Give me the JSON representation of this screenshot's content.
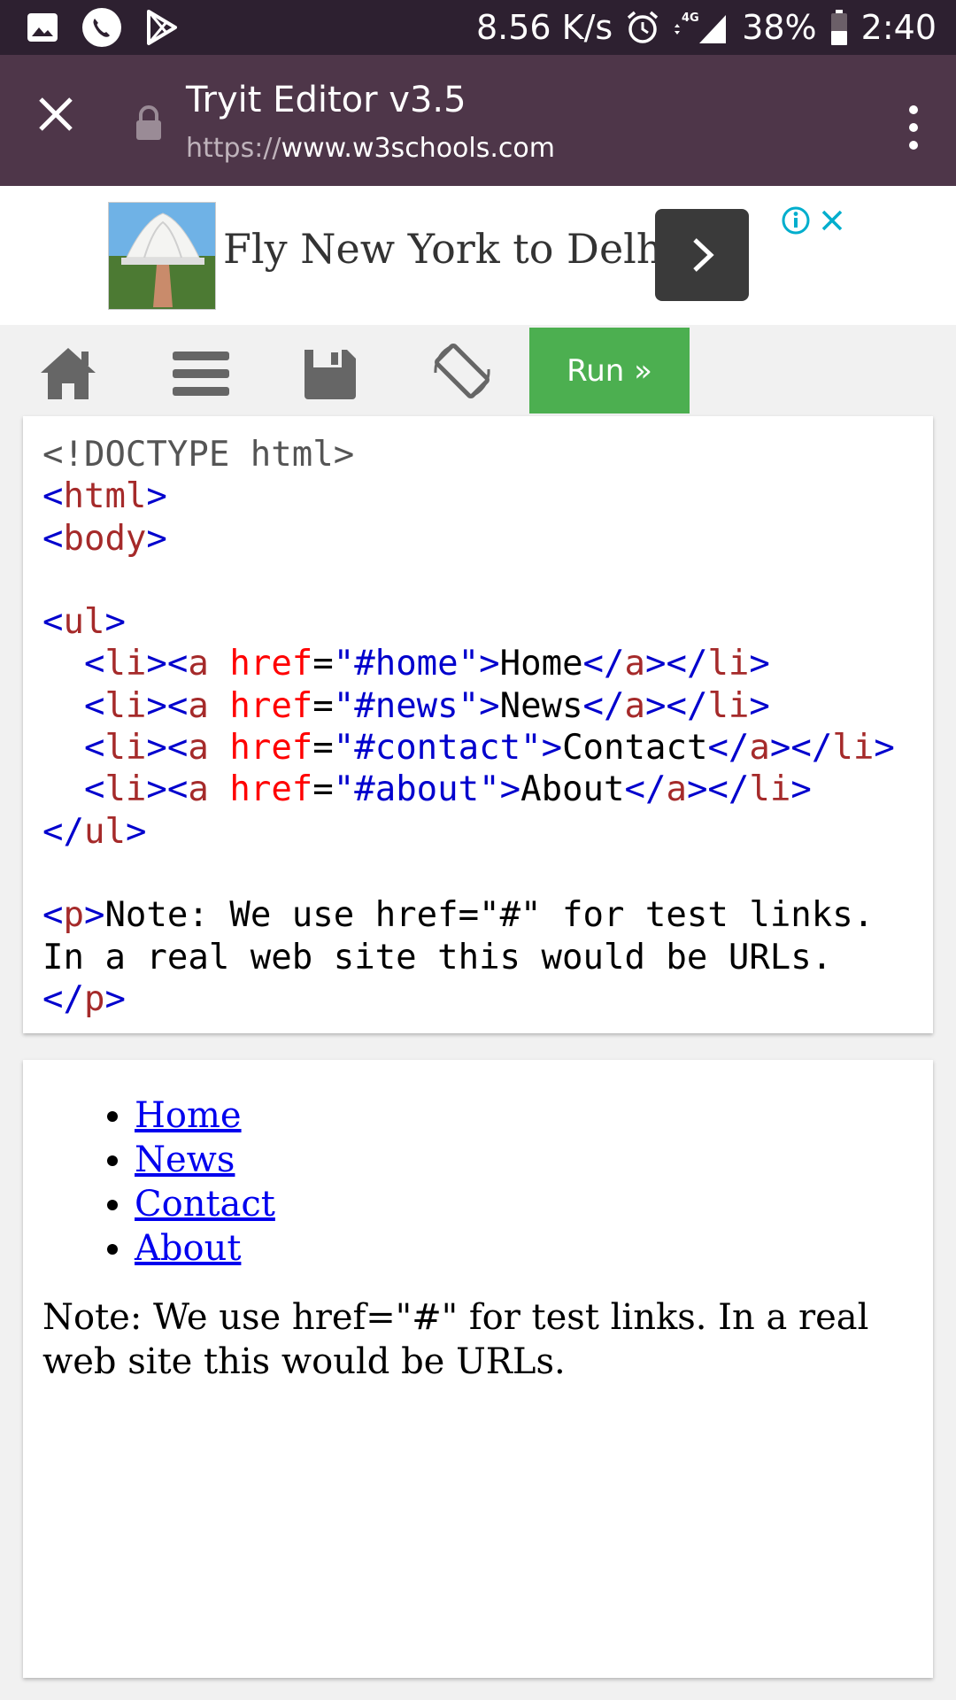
{
  "status_bar": {
    "net_speed": "8.56 K/s",
    "network": "4G",
    "battery": "38%",
    "time": "2:40",
    "icons": [
      "image-icon",
      "phone-icon",
      "play-store-icon",
      "alarm-icon",
      "signal-icon",
      "battery-icon"
    ]
  },
  "tab": {
    "title": "Tryit Editor v3.5",
    "url_protocol": "https://",
    "url_host": "www.w3schools.com"
  },
  "ad": {
    "text": "Fly New York to Delhi",
    "info_color": "#00aecd"
  },
  "toolbar": {
    "run_label": "Run »",
    "run_color": "#4caf50"
  },
  "code": {
    "doctype": "<!DOCTYPE html>",
    "tag_html": "html",
    "tag_body": "body",
    "tag_ul": "ul",
    "tag_li": "li",
    "tag_a": "a",
    "tag_p": "p",
    "attr_href": "href",
    "items": [
      {
        "href": "\"#home\"",
        "text": "Home"
      },
      {
        "href": "\"#news\"",
        "text": "News"
      },
      {
        "href": "\"#contact\"",
        "text": "Contact"
      },
      {
        "href": "\"#about\"",
        "text": "About"
      }
    ],
    "note_line1": "Note: We use href=\"#\" for test links.",
    "note_line2": "In a real web site this would be URLs."
  },
  "result": {
    "links": [
      "Home",
      "News",
      "Contact",
      "About"
    ],
    "note": "Note: We use href=\"#\" for test links. In a real web site this would be URLs."
  }
}
